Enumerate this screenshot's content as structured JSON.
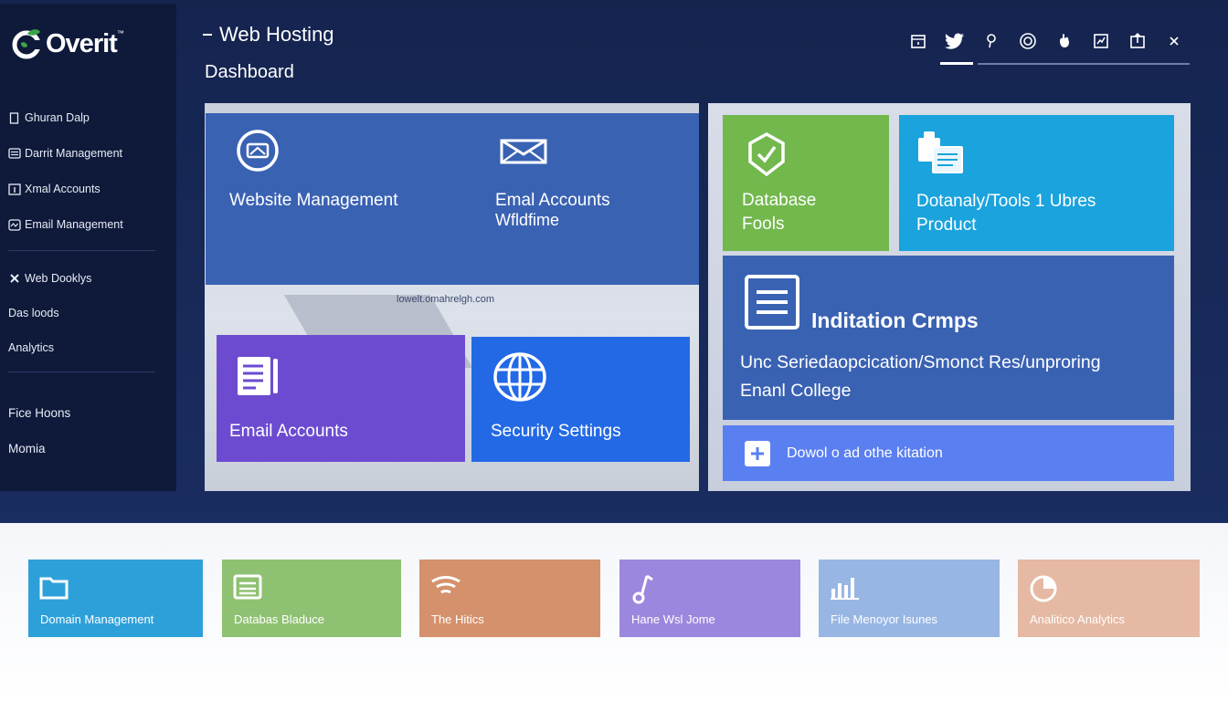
{
  "app": {
    "logo_text": "Overit",
    "header_title": "Web Hosting",
    "page_title": "Dashboard"
  },
  "sidebar": {
    "items": [
      {
        "label": "Ghuran Dalp",
        "icon": "file-icon"
      },
      {
        "label": "Darrit Management",
        "icon": "list-icon"
      },
      {
        "label": "Xmal Accounts",
        "icon": "info-icon"
      },
      {
        "label": "Email Management",
        "icon": "mail-icon"
      },
      {
        "label": "Web Dooklys",
        "icon": "tools-icon"
      },
      {
        "label": "Das loods",
        "icon": ""
      },
      {
        "label": "Analytics",
        "icon": ""
      },
      {
        "label": "Fice Hoons",
        "icon": ""
      },
      {
        "label": "Momia",
        "icon": ""
      }
    ]
  },
  "toolbar": {
    "icons": [
      "calendar-icon",
      "twitter-icon",
      "pin-icon",
      "settings-circle-icon",
      "hand-icon",
      "chart-doc-icon",
      "upload-doc-icon",
      "close-icon"
    ]
  },
  "cards": {
    "website_management": "Website Management",
    "email_accounts_top": "Emal Accounts",
    "email_accounts_top_sub": "Wfldfime",
    "panel_link": "lowelt.omahrelgh.com",
    "email_accounts": "Email Accounts",
    "security_settings": "Security Settings",
    "database_tools_line1": "Database",
    "database_tools_line2": "Fools",
    "dotanaly_line1": "Dotanaly/Tools 1 Ubres",
    "dotanaly_line2": "Product",
    "indit_title": "Inditation Crmps",
    "indit_text_line1": "Unc Seriedaopcication/Smonct Res/unproring",
    "indit_text_line2": "Enanl College",
    "download_label": "Dowol o ad othe kitation"
  },
  "tiles": [
    {
      "label": "Domain Management",
      "color": "#2ea0d9"
    },
    {
      "label": "Databas Bladuce",
      "color": "#8fc172"
    },
    {
      "label": "The Hitics",
      "color": "#d5916b"
    },
    {
      "label": "Hane Wsl Jome",
      "color": "#9c87de"
    },
    {
      "label": "File Menoyor Isunes",
      "color": "#98b6e4"
    },
    {
      "label": "Analitico Analytics",
      "color": "#e5b9a3"
    }
  ],
  "colors": {
    "sidebar_bg": "#0f1a3a",
    "header_bg": "#15244f",
    "card_blue": "#3a62b3",
    "card_purple": "#6c4bd0",
    "card_bright_blue": "#2369e6",
    "card_green": "#72b84d",
    "card_cyan": "#1aa3dd",
    "download_bar": "#5a7ff0"
  }
}
